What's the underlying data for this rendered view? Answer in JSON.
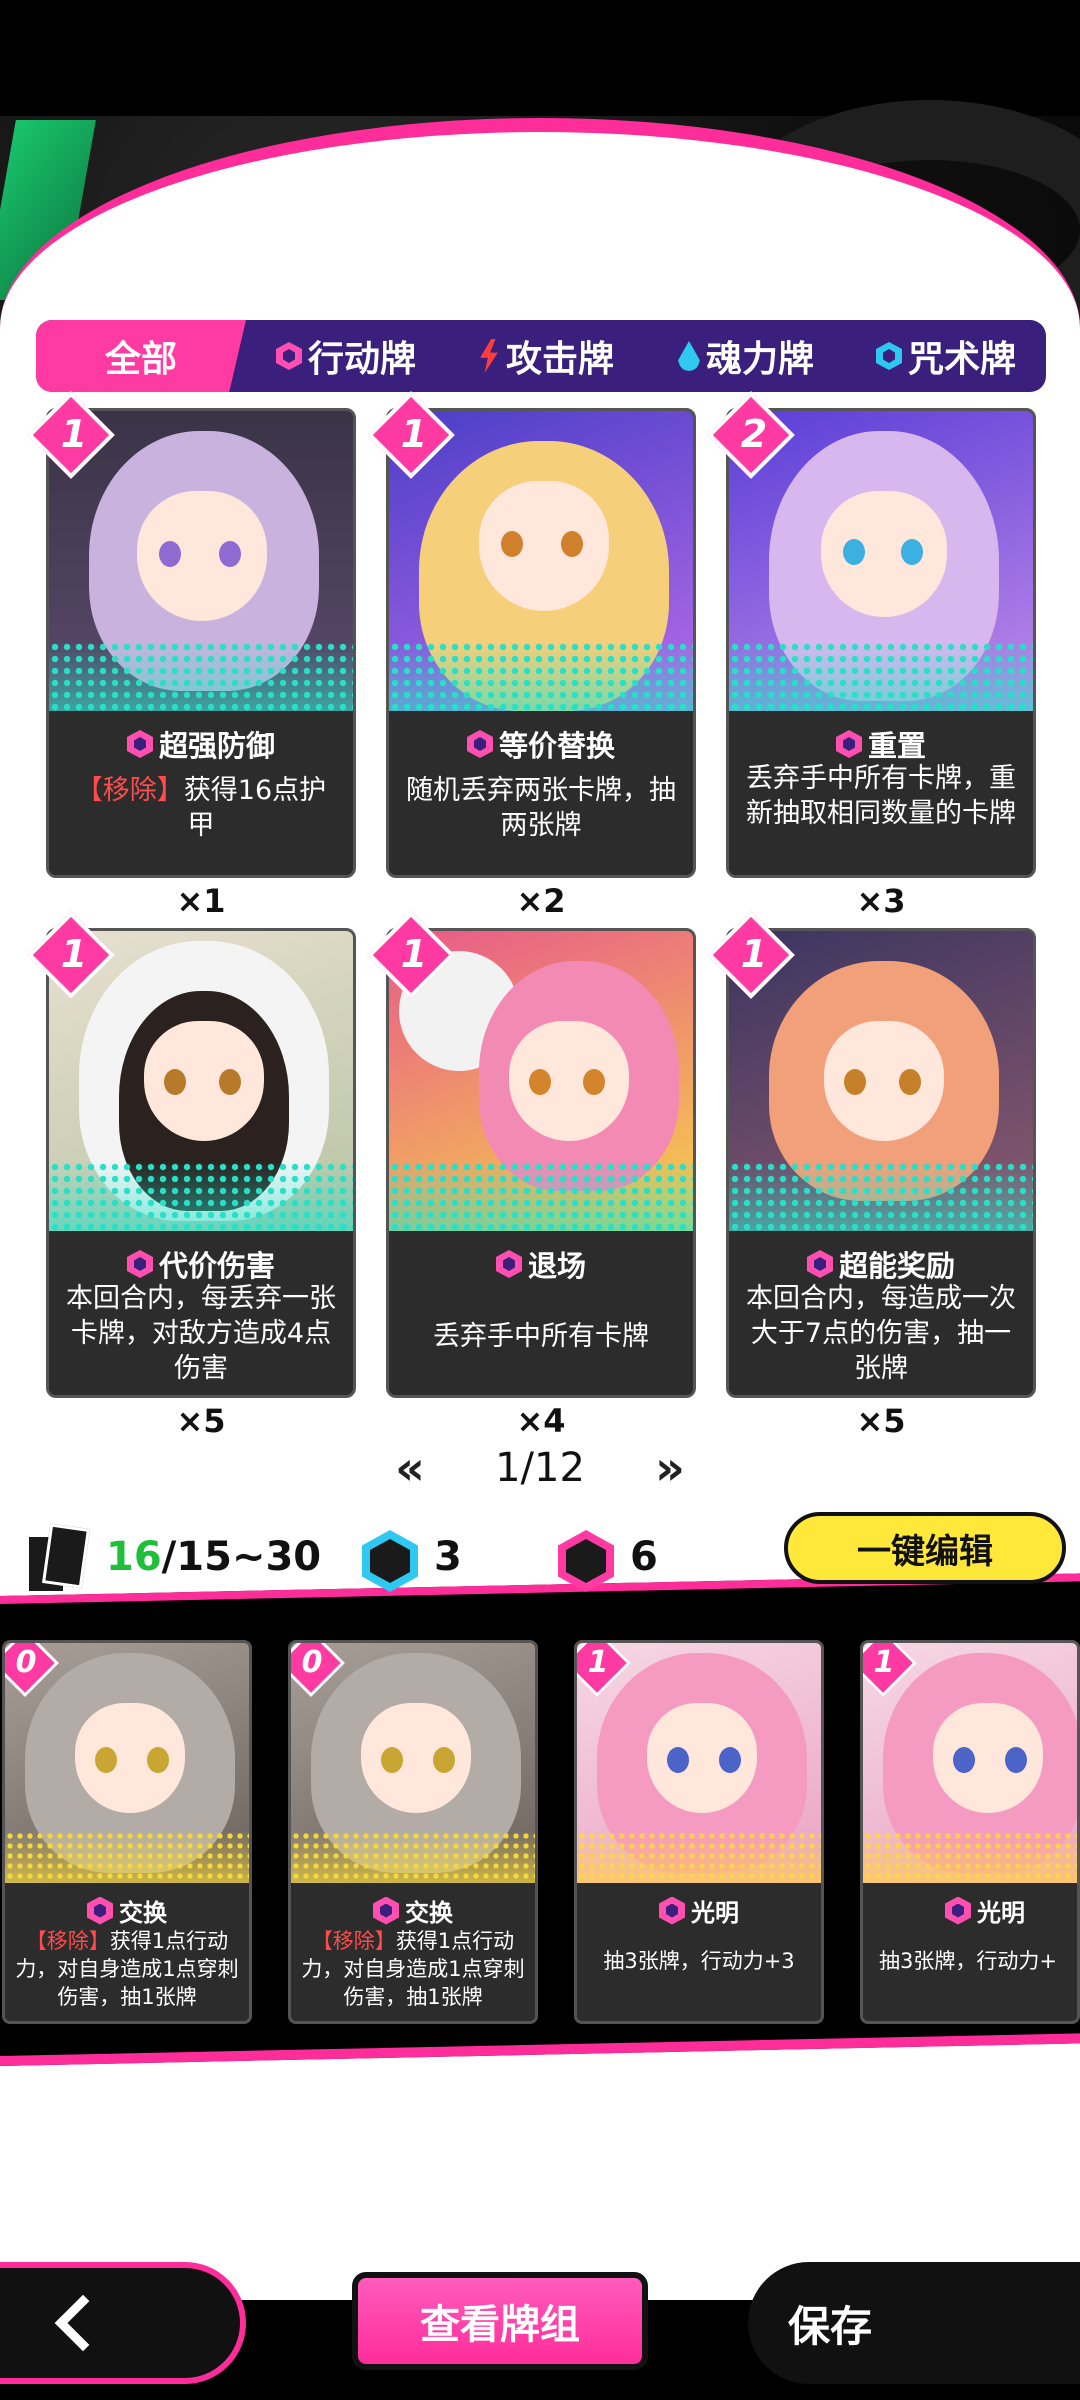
{
  "tabs": [
    {
      "label": "全部",
      "icon": "none"
    },
    {
      "label": "行动牌",
      "icon": "hexagon-pink-icon"
    },
    {
      "label": "攻击牌",
      "icon": "lightning-icon"
    },
    {
      "label": "魂力牌",
      "icon": "droplet-icon"
    },
    {
      "label": "咒术牌",
      "icon": "hexagon-cyan-icon"
    }
  ],
  "cards": [
    {
      "cost": "1",
      "name": "超强防御",
      "tag": "【移除】",
      "desc": "获得16点护甲",
      "count": "×1"
    },
    {
      "cost": "1",
      "name": "等价替换",
      "tag": "",
      "desc": "随机丢弃两张卡牌，抽两张牌",
      "count": "×2"
    },
    {
      "cost": "2",
      "name": "重置",
      "tag": "",
      "desc": "丢弃手中所有卡牌，重新抽取相同数量的卡牌",
      "count": "×3"
    },
    {
      "cost": "1",
      "name": "代价伤害",
      "tag": "",
      "desc": "本回合内，每丢弃一张卡牌，对敌方造成4点伤害",
      "count": "×5"
    },
    {
      "cost": "1",
      "name": "退场",
      "tag": "",
      "desc": "丢弃手中所有卡牌",
      "count": "×4"
    },
    {
      "cost": "1",
      "name": "超能奖励",
      "tag": "",
      "desc": "本回合内，每造成一次大于7点的伤害，抽一张牌",
      "count": "×5"
    }
  ],
  "pager": {
    "prev": "«",
    "text": "1/12",
    "next": "»"
  },
  "deck": {
    "current": "16",
    "range": "/15~30",
    "stat1": "3",
    "stat2": "6",
    "edit_label": "一键编辑"
  },
  "deck_cards": [
    {
      "cost": "0",
      "name": "交换",
      "tag": "【移除】",
      "desc": "获得1点行动力，对自身造成1点穿刺伤害，抽1张牌"
    },
    {
      "cost": "0",
      "name": "交换",
      "tag": "【移除】",
      "desc": "获得1点行动力，对自身造成1点穿刺伤害，抽1张牌"
    },
    {
      "cost": "1",
      "name": "光明",
      "tag": "",
      "desc": "抽3张牌，行动力+3"
    },
    {
      "cost": "1",
      "name": "光明",
      "tag": "",
      "desc": "抽3张牌，行动力+"
    }
  ],
  "bottom": {
    "view_label": "查看牌组",
    "save_label": "保存"
  },
  "colors": {
    "accent": "#ff2d9a",
    "tab_bg": "#3a1f7c",
    "edit_btn": "#ffe83a",
    "deck_green": "#1fbf3a"
  }
}
